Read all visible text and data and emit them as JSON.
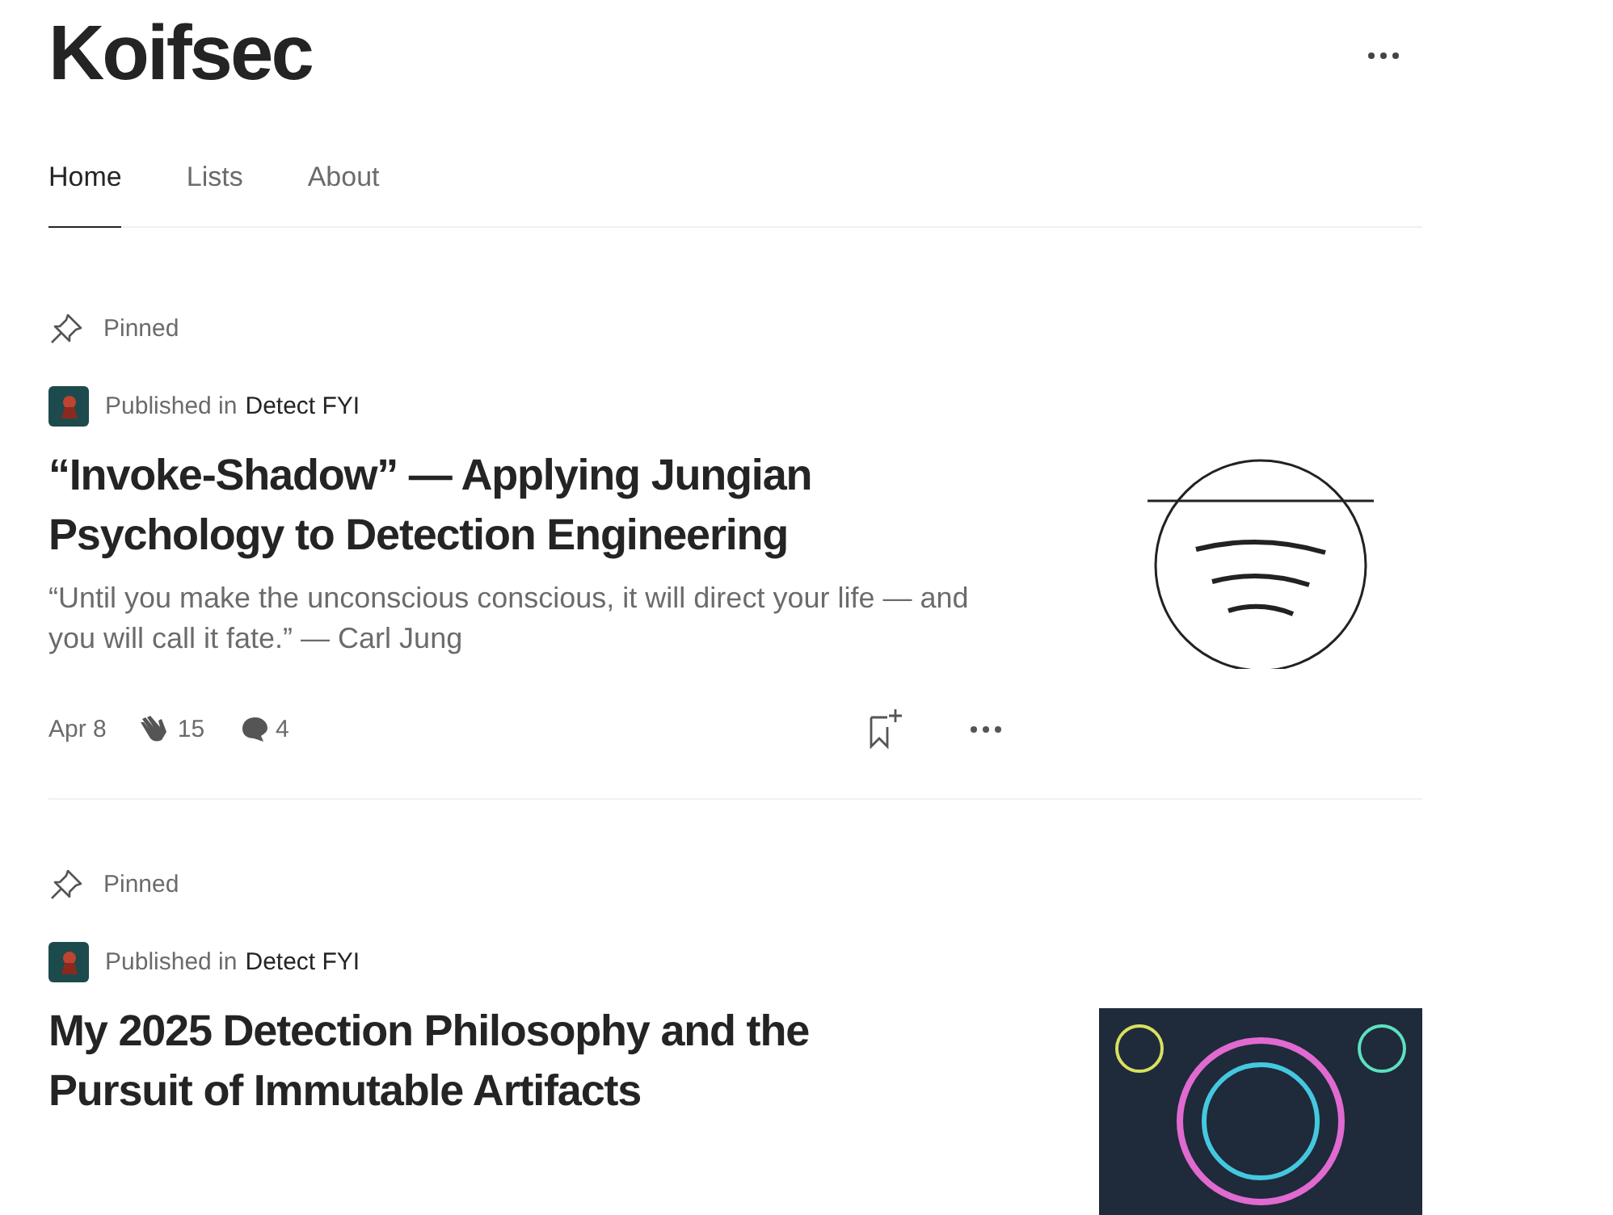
{
  "header": {
    "title": "Koifsec"
  },
  "tabs": [
    {
      "label": "Home",
      "selected": true
    },
    {
      "label": "Lists",
      "selected": false
    },
    {
      "label": "About",
      "selected": false
    }
  ],
  "posts": [
    {
      "pinned_label": "Pinned",
      "published_prefix": "Published in",
      "publication": "Detect FYI",
      "title": "“Invoke-Shadow” — Applying Jungian Psychology to Detection Engineering",
      "subtitle": "“Until you make the unconscious conscious, it will direct your life — and you will call it fate.” — Carl Jung",
      "date": "Apr 8",
      "claps": "15",
      "comments": "4",
      "thumbnail": {
        "kind": "sketch"
      }
    },
    {
      "pinned_label": "Pinned",
      "published_prefix": "Published in",
      "publication": "Detect FYI",
      "title": "My 2025 Detection Philosophy and the Pursuit of Immutable Artifacts",
      "thumbnail": {
        "kind": "dark"
      }
    }
  ]
}
